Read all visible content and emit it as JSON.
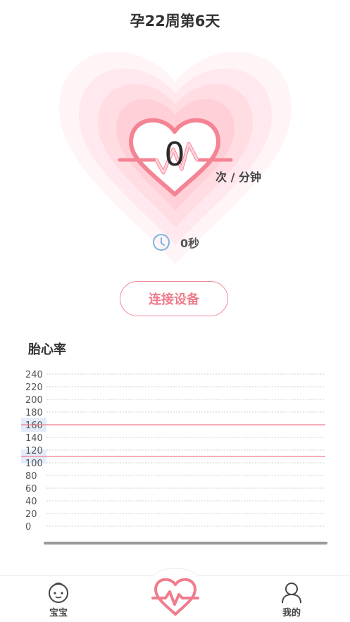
{
  "header": {
    "title": "孕22周第6天"
  },
  "monitor": {
    "bpm_value": "0",
    "bpm_unit": "次 / 分钟",
    "duration": "0秒",
    "connect_label": "连接设备"
  },
  "chart_section": {
    "title": "胎心率"
  },
  "chart_data": {
    "type": "line",
    "title": "胎心率",
    "y_ticks": [
      "240",
      "220",
      "200",
      "180",
      "160",
      "140",
      "120",
      "100",
      "80",
      "60",
      "40",
      "20",
      "0"
    ],
    "ylim": [
      0,
      240
    ],
    "series": [],
    "reference_lines": [
      160,
      110
    ],
    "highlight_labels": [
      "160",
      "110"
    ],
    "grid": true,
    "colors": {
      "reference": "#f07c8c",
      "grid": "#cfcfcf",
      "highlight": "#e4ecfb"
    }
  },
  "tabbar": {
    "items": [
      {
        "label": "宝宝",
        "icon": "baby-face-icon"
      },
      {
        "label": "",
        "icon": "heartbeat-icon"
      },
      {
        "label": "我的",
        "icon": "person-icon"
      }
    ]
  },
  "colors": {
    "accent": "#f07c8c",
    "heart_light": "#fde8ec"
  }
}
